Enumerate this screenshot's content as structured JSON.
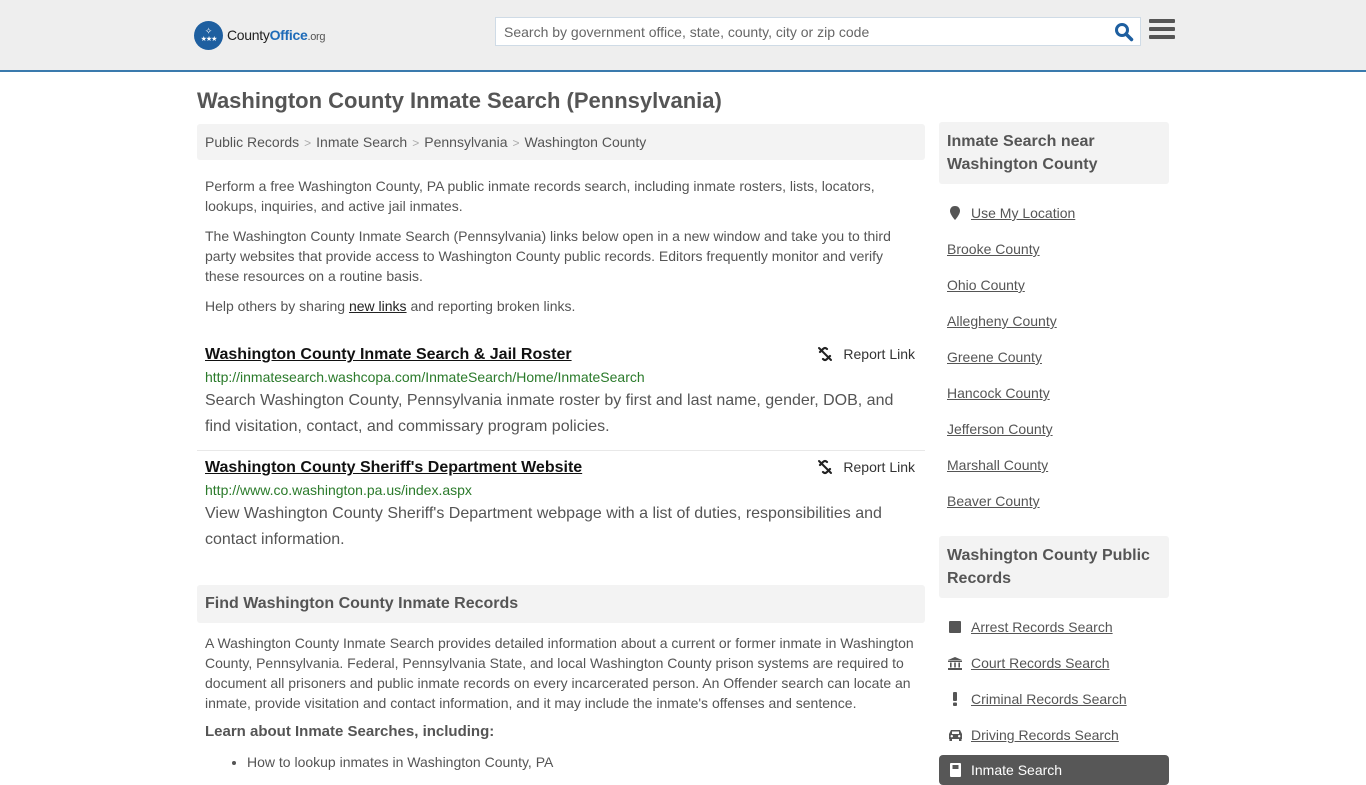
{
  "header": {
    "logo": {
      "name": "County",
      "name_bold": "Office",
      "tld": ".org"
    },
    "search": {
      "placeholder": "Search by government office, state, county, city or zip code",
      "value": ""
    },
    "accent_color": "#3a7aad"
  },
  "page": {
    "title": "Washington County Inmate Search (Pennsylvania)"
  },
  "breadcrumb": [
    "Public Records",
    "Inmate Search",
    "Pennsylvania",
    "Washington County"
  ],
  "intro": {
    "p1": "Perform a free Washington County, PA public inmate records search, including inmate rosters, lists, locators, lookups, inquiries, and active jail inmates.",
    "p2": "The Washington County Inmate Search (Pennsylvania) links below open in a new window and take you to third party websites that provide access to Washington County public records. Editors frequently monitor and verify these resources on a routine basis.",
    "p3_before": "Help others by sharing ",
    "p3_link": "new links",
    "p3_after": " and reporting broken links."
  },
  "links": [
    {
      "title": "Washington County Inmate Search & Jail Roster",
      "report": "Report Link",
      "url": "http://inmatesearch.washcopa.com/InmateSearch/Home/InmateSearch",
      "description": "Search Washington County, Pennsylvania inmate roster by first and last name, gender, DOB, and find visitation, contact, and commissary program policies."
    },
    {
      "title": "Washington County Sheriff's Department Website",
      "report": "Report Link",
      "url": "http://www.co.washington.pa.us/index.aspx",
      "description": "View Washington County Sheriff's Department webpage with a list of duties, responsibilities and contact information."
    }
  ],
  "find": {
    "heading": "Find Washington County Inmate Records",
    "body": "A Washington County Inmate Search provides detailed information about a current or former inmate in Washington County, Pennsylvania. Federal, Pennsylvania State, and local Washington County prison systems are required to document all prisoners and public inmate records on every incarcerated person. An Offender search can locate an inmate, provide visitation and contact information, and it may include the inmate's offenses and sentence.",
    "learn_heading": "Learn about Inmate Searches, including:",
    "list_partial": "How to lookup inmates in Washington County, PA"
  },
  "sidebar": {
    "nearby": {
      "heading": "Inmate Search near Washington County",
      "use_location": "Use My Location",
      "counties": [
        "Brooke County",
        "Ohio County",
        "Allegheny County",
        "Greene County",
        "Hancock County",
        "Jefferson County",
        "Marshall County",
        "Beaver County"
      ]
    },
    "public_records": {
      "heading": "Washington County Public Records",
      "items": [
        {
          "label": "Arrest Records Search",
          "icon": "square-icon"
        },
        {
          "label": "Court Records Search",
          "icon": "courthouse-icon"
        },
        {
          "label": "Criminal Records Search",
          "icon": "exclamation-icon"
        },
        {
          "label": "Driving Records Search",
          "icon": "car-icon"
        }
      ],
      "active": {
        "label": "Inmate Search",
        "icon": "door-icon"
      }
    }
  }
}
